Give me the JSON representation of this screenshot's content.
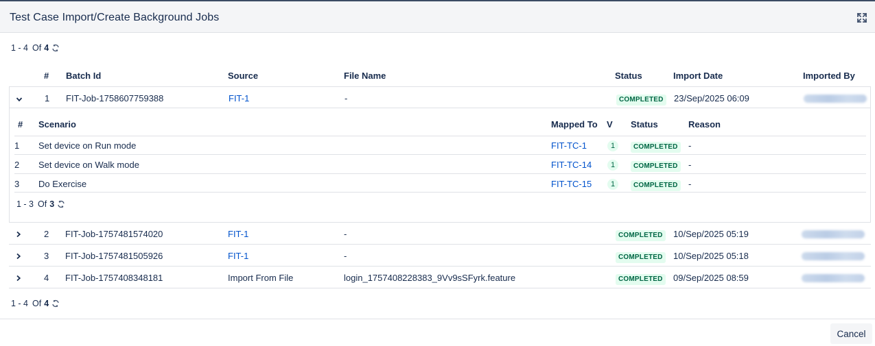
{
  "header": {
    "title": "Test Case Import/Create Background Jobs"
  },
  "pager_top": {
    "range": "1 - 4",
    "of_label": "Of",
    "total": "4"
  },
  "pager_bottom": {
    "range": "1 - 4",
    "of_label": "Of",
    "total": "4"
  },
  "columns": {
    "index": "#",
    "batch_id": "Batch Id",
    "source": "Source",
    "file_name": "File Name",
    "status": "Status",
    "import_date": "Import Date",
    "imported_by": "Imported By"
  },
  "jobs": [
    {
      "index": "1",
      "batch_id": "FIT-Job-1758607759388",
      "source": "FIT-1",
      "file_name": "-",
      "status": "COMPLETED",
      "import_date": "23/Sep/2025 06:09",
      "expanded": true
    },
    {
      "index": "2",
      "batch_id": "FIT-Job-1757481574020",
      "source": "FIT-1",
      "file_name": "-",
      "status": "COMPLETED",
      "import_date": "10/Sep/2025 05:19",
      "expanded": false
    },
    {
      "index": "3",
      "batch_id": "FIT-Job-1757481505926",
      "source": "FIT-1",
      "file_name": "-",
      "status": "COMPLETED",
      "import_date": "10/Sep/2025 05:18",
      "expanded": false
    },
    {
      "index": "4",
      "batch_id": "FIT-Job-1757408348181",
      "source": "Import From File",
      "file_name": "login_1757408228383_9Vv9sSFyrk.feature",
      "status": "COMPLETED",
      "import_date": "09/Sep/2025 08:59",
      "expanded": false
    }
  ],
  "sub": {
    "columns": {
      "index": "#",
      "scenario": "Scenario",
      "mapped_to": "Mapped To",
      "version": "V",
      "status": "Status",
      "reason": "Reason"
    },
    "rows": [
      {
        "index": "1",
        "scenario": "Set device on Run mode",
        "mapped_to": "FIT-TC-1",
        "version": "1",
        "status": "COMPLETED",
        "reason": "-"
      },
      {
        "index": "2",
        "scenario": "Set device on Walk mode",
        "mapped_to": "FIT-TC-14",
        "version": "1",
        "status": "COMPLETED",
        "reason": "-"
      },
      {
        "index": "3",
        "scenario": "Do Exercise",
        "mapped_to": "FIT-TC-15",
        "version": "1",
        "status": "COMPLETED",
        "reason": "-"
      }
    ],
    "pager": {
      "range": "1 - 3",
      "of_label": "Of",
      "total": "3"
    }
  },
  "footer": {
    "cancel_label": "Cancel"
  },
  "colors": {
    "link": "#0052cc",
    "status_bg": "#e3fcef",
    "status_text": "#006644",
    "header_bg": "#f4f5f7"
  }
}
